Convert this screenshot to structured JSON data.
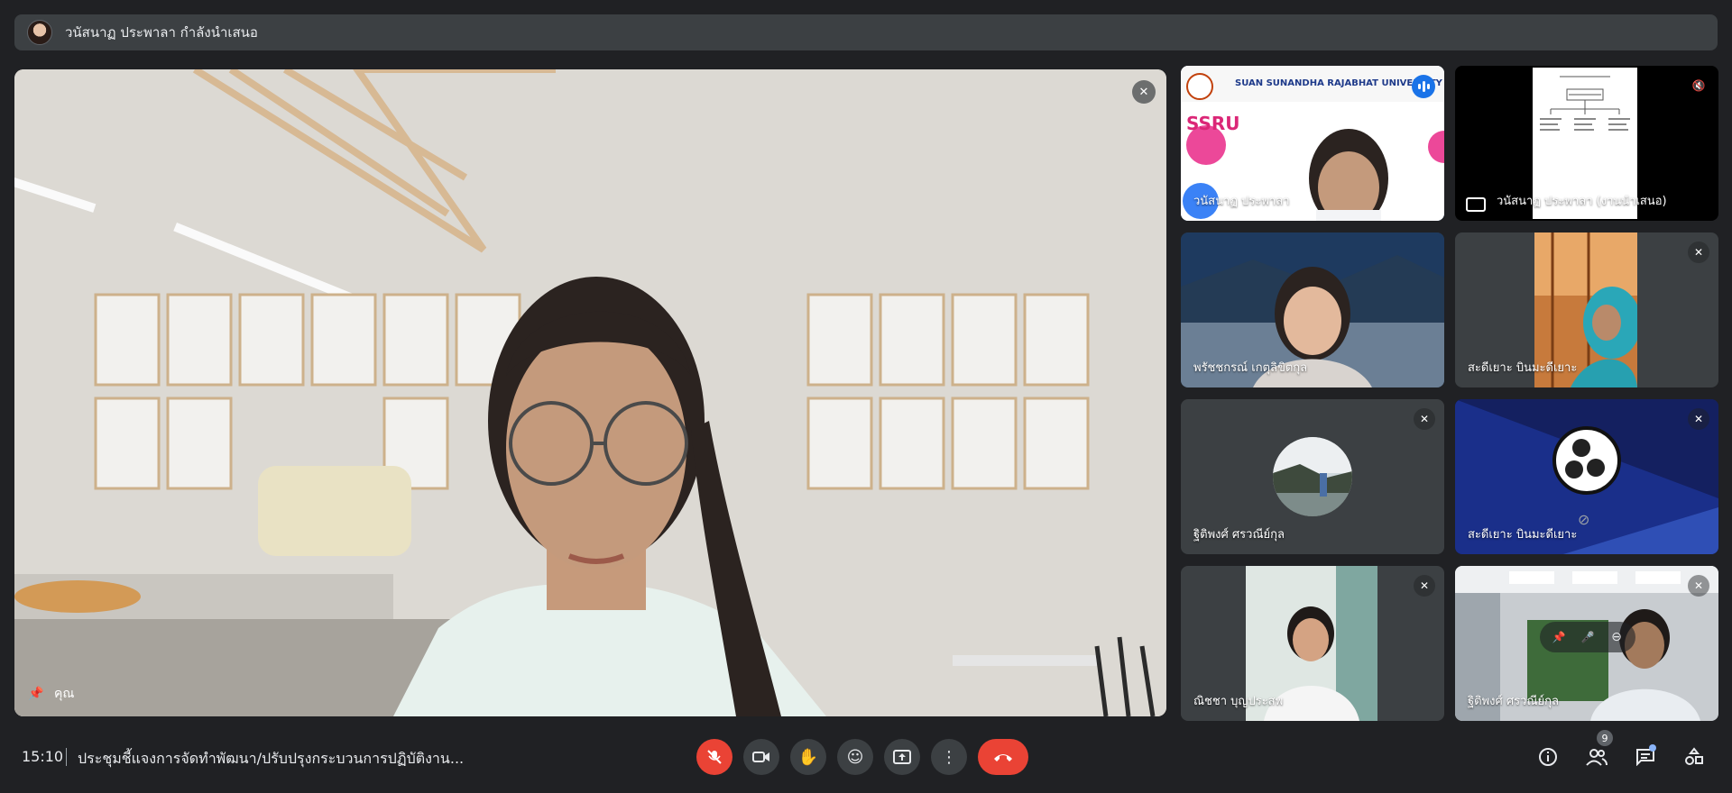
{
  "banner": {
    "presenting_text": "วนัสนาฏ ประพาลา กำลังนำเสนอ"
  },
  "stage": {
    "self_label": "คุณ"
  },
  "tiles": [
    {
      "label": "วนัสนาฏ ประพาลา",
      "banner_text": "SUAN SUNANDHA RAJABHAT UNIVERSITY",
      "logo_text": "SSRU"
    },
    {
      "label": "วนัสนาฏ ประพาลา (งานนำเสนอ)"
    },
    {
      "label": "พรัชชกรณ์ เกตุลิขิตกุล"
    },
    {
      "label": "สะดีเยาะ บินมะดีเยาะ"
    },
    {
      "label": "ฐิติพงศ์ ศรวณีย์กุล"
    },
    {
      "label": "สะดีเยาะ บินมะดีเยาะ"
    },
    {
      "label": "ณิชชา บุญประสพ"
    },
    {
      "label": "ฐิติพงศ์ ศรวณีย์กุล"
    }
  ],
  "footer": {
    "time": "15:10",
    "meeting_title": "ประชุมชี้แจงการจัดทำพัฒนา/ปรับปรุงกระบวนการปฏิบัติงาน...",
    "participant_count": "9"
  },
  "colors": {
    "accent": "#8ab4f8",
    "danger": "#ea4335",
    "surface": "#3c4043",
    "background": "#202124"
  }
}
